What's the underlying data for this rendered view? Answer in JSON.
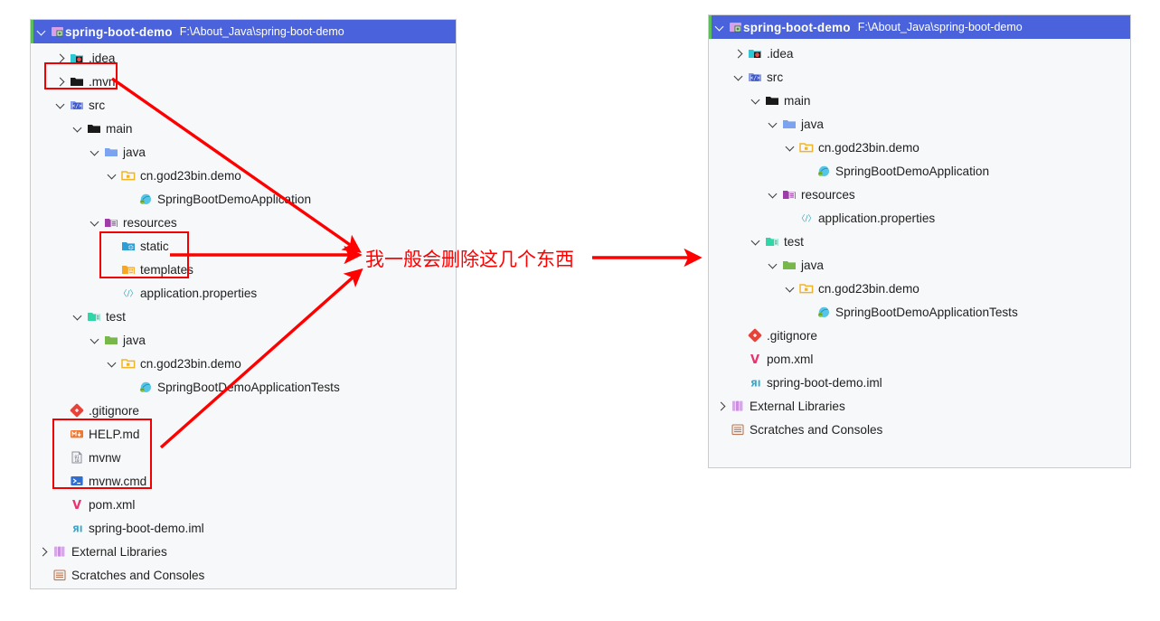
{
  "left_panel": {
    "header": {
      "project_name": "spring-boot-demo",
      "project_path": "F:\\About_Java\\spring-boot-demo"
    },
    "rows": [
      {
        "label": ".idea",
        "icon": "idea-folder-icon",
        "chevron": "right",
        "indent": 1
      },
      {
        "label": ".mvn",
        "icon": "black-folder-icon",
        "chevron": "right",
        "indent": 1
      },
      {
        "label": "src",
        "icon": "src-folder-icon",
        "chevron": "down",
        "indent": 1
      },
      {
        "label": "main",
        "icon": "black-folder-icon",
        "chevron": "down",
        "indent": 2
      },
      {
        "label": "java",
        "icon": "blue-folder-icon",
        "chevron": "down",
        "indent": 3
      },
      {
        "label": "cn.god23bin.demo",
        "icon": "package-icon",
        "chevron": "down",
        "indent": 4
      },
      {
        "label": "SpringBootDemoApplication",
        "icon": "spring-class-icon",
        "chevron": "none",
        "indent": 5
      },
      {
        "label": "resources",
        "icon": "resources-folder-icon",
        "chevron": "down",
        "indent": 3
      },
      {
        "label": "static",
        "icon": "static-folder-icon",
        "chevron": "none",
        "indent": 4
      },
      {
        "label": "templates",
        "icon": "templates-folder-icon",
        "chevron": "none",
        "indent": 4
      },
      {
        "label": "application.properties",
        "icon": "properties-icon",
        "chevron": "none",
        "indent": 4
      },
      {
        "label": "test",
        "icon": "test-folder-icon",
        "chevron": "down",
        "indent": 2
      },
      {
        "label": "java",
        "icon": "green-folder-icon",
        "chevron": "down",
        "indent": 3
      },
      {
        "label": "cn.god23bin.demo",
        "icon": "package-icon",
        "chevron": "down",
        "indent": 4
      },
      {
        "label": "SpringBootDemoApplicationTests",
        "icon": "spring-class-icon",
        "chevron": "none",
        "indent": 5
      },
      {
        "label": ".gitignore",
        "icon": "git-icon",
        "chevron": "none",
        "indent": 1
      },
      {
        "label": "HELP.md",
        "icon": "markdown-icon",
        "chevron": "none",
        "indent": 1
      },
      {
        "label": "mvnw",
        "icon": "binary-file-icon",
        "chevron": "none",
        "indent": 1
      },
      {
        "label": "mvnw.cmd",
        "icon": "cmd-icon",
        "chevron": "none",
        "indent": 1
      },
      {
        "label": "pom.xml",
        "icon": "maven-icon",
        "chevron": "none",
        "indent": 1
      },
      {
        "label": "spring-boot-demo.iml",
        "icon": "iml-icon",
        "chevron": "none",
        "indent": 1
      },
      {
        "label": "External Libraries",
        "icon": "library-icon",
        "chevron": "right",
        "indent": 0
      },
      {
        "label": "Scratches and Consoles",
        "icon": "scratches-icon",
        "chevron": "none",
        "indent": 0
      }
    ]
  },
  "right_panel": {
    "header": {
      "project_name": "spring-boot-demo",
      "project_path": "F:\\About_Java\\spring-boot-demo"
    },
    "rows": [
      {
        "label": ".idea",
        "icon": "idea-folder-icon",
        "chevron": "right",
        "indent": 1
      },
      {
        "label": "src",
        "icon": "src-folder-icon",
        "chevron": "down",
        "indent": 1
      },
      {
        "label": "main",
        "icon": "black-folder-icon",
        "chevron": "down",
        "indent": 2
      },
      {
        "label": "java",
        "icon": "blue-folder-icon",
        "chevron": "down",
        "indent": 3
      },
      {
        "label": "cn.god23bin.demo",
        "icon": "package-icon",
        "chevron": "down",
        "indent": 4
      },
      {
        "label": "SpringBootDemoApplication",
        "icon": "spring-class-icon",
        "chevron": "none",
        "indent": 5
      },
      {
        "label": "resources",
        "icon": "resources-folder-icon",
        "chevron": "down",
        "indent": 3
      },
      {
        "label": "application.properties",
        "icon": "properties-icon",
        "chevron": "none",
        "indent": 4
      },
      {
        "label": "test",
        "icon": "test-folder-icon",
        "chevron": "down",
        "indent": 2
      },
      {
        "label": "java",
        "icon": "green-folder-icon",
        "chevron": "down",
        "indent": 3
      },
      {
        "label": "cn.god23bin.demo",
        "icon": "package-icon",
        "chevron": "down",
        "indent": 4
      },
      {
        "label": "SpringBootDemoApplicationTests",
        "icon": "spring-class-icon",
        "chevron": "none",
        "indent": 5
      },
      {
        "label": ".gitignore",
        "icon": "git-icon",
        "chevron": "none",
        "indent": 1
      },
      {
        "label": "pom.xml",
        "icon": "maven-icon",
        "chevron": "none",
        "indent": 1
      },
      {
        "label": "spring-boot-demo.iml",
        "icon": "iml-icon",
        "chevron": "none",
        "indent": 1
      },
      {
        "label": "External Libraries",
        "icon": "library-icon",
        "chevron": "right",
        "indent": 0
      },
      {
        "label": "Scratches and Consoles",
        "icon": "scratches-icon",
        "chevron": "none",
        "indent": 0
      }
    ]
  },
  "annotation": {
    "note": "我一般会删除这几个东西",
    "color": "#ff0000",
    "highlight_boxes": [
      {
        "name": "mvn-highlight",
        "targets": ".mvn"
      },
      {
        "name": "static-templates-highlight",
        "targets": "static, templates"
      },
      {
        "name": "maven-wrapper-highlight",
        "targets": "HELP.md, mvnw, mvnw.cmd"
      }
    ]
  },
  "colors": {
    "header_bg": "#4a62db",
    "header_accent": "#5bbd5b",
    "panel_bg": "#f7f8fa",
    "panel_border": "#c9ccd1",
    "annotation_red": "#ff0000",
    "text": "#1f1f1f"
  }
}
